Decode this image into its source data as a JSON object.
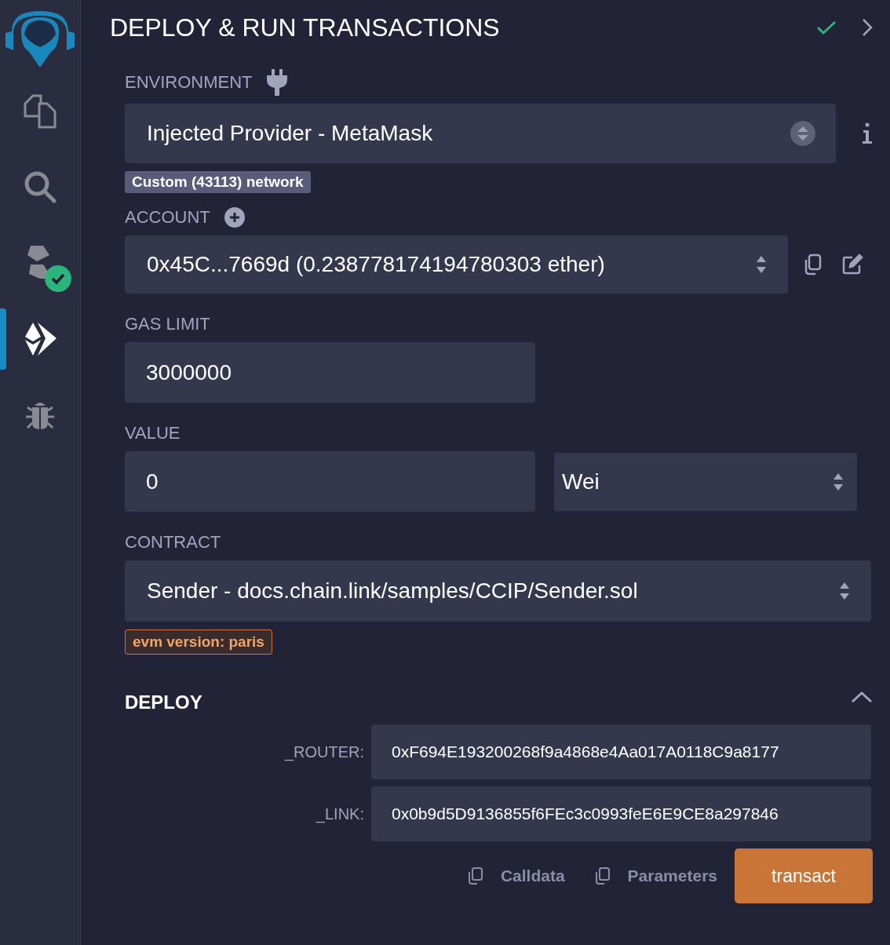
{
  "sidebar": {
    "items": [
      {
        "kind": "logo",
        "selected": false
      },
      {
        "kind": "files",
        "selected": false
      },
      {
        "kind": "search",
        "selected": false
      },
      {
        "kind": "compiler",
        "selected": false,
        "compiled": true
      },
      {
        "kind": "deploy",
        "selected": true
      },
      {
        "kind": "debugger",
        "selected": false
      }
    ]
  },
  "header": {
    "title": "DEPLOY & RUN TRANSACTIONS",
    "checked": true
  },
  "environment": {
    "label": "ENVIRONMENT",
    "value": "Injected Provider - MetaMask",
    "network": "Custom (43113) network"
  },
  "account": {
    "label": "ACCOUNT",
    "value": "0x45C...7669d (0.238778174194780303 ether)"
  },
  "gas_limit": {
    "label": "GAS LIMIT",
    "value": "3000000"
  },
  "value": {
    "label": "VALUE",
    "value": "0",
    "unit": "Wei"
  },
  "contract": {
    "label": "CONTRACT",
    "value": "Sender - docs.chain.link/samples/CCIP/Sender.sol",
    "evm": "evm version: paris"
  },
  "deploy": {
    "title": "DEPLOY",
    "expanded": true,
    "params": [
      {
        "label": "_ROUTER:",
        "value": "0xF694E193200268f9a4868e4Aa017A0118C9a8177"
      },
      {
        "label": "_LINK:",
        "value": "0x0b9d5D9136855f6FEc3c0993feE6E9CE8a297846"
      }
    ],
    "actions": [
      "Calldata",
      "Parameters"
    ],
    "button": "transact"
  }
}
